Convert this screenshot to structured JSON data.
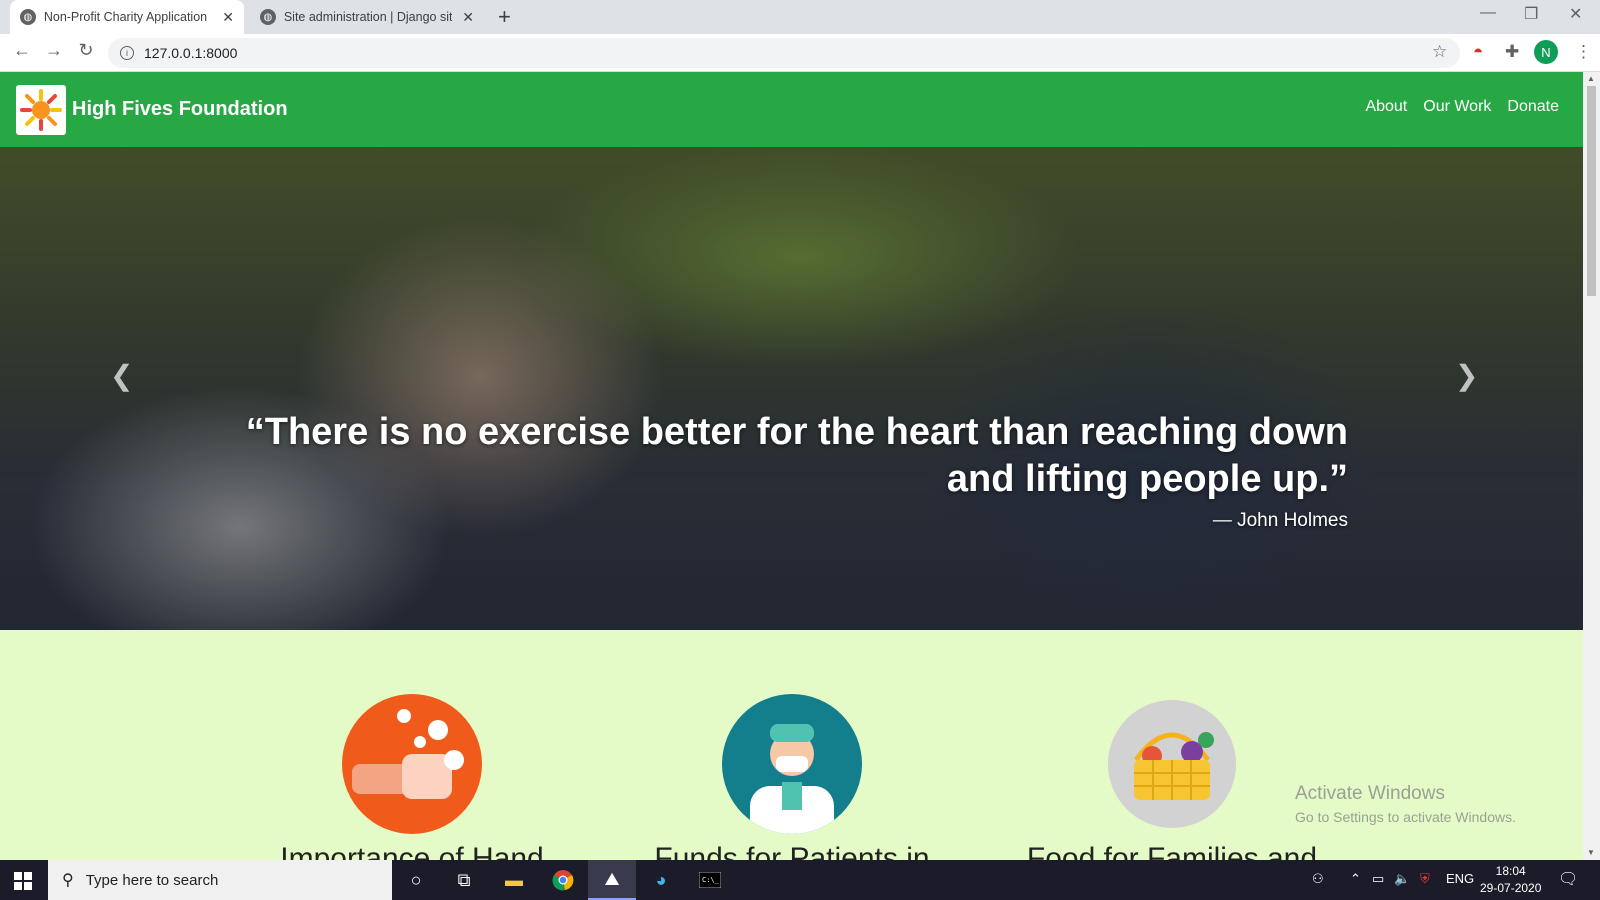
{
  "browser": {
    "tabs": [
      {
        "title": "Non-Profit Charity Application",
        "active": true
      },
      {
        "title": "Site administration | Django site",
        "active": false
      }
    ],
    "address": "127.0.0.1:8000",
    "profile_initial": "N"
  },
  "site": {
    "brand": "High Fives Foundation",
    "nav": [
      "About",
      "Our Work",
      "Donate"
    ],
    "hero": {
      "quote": "“There is no exercise better for the heart than reaching down and lifting people up.”",
      "author": "— John Holmes",
      "slides": 3,
      "active_slide": 3
    },
    "features": [
      {
        "title": "Importance of Hand",
        "icon": "hand-washing-icon",
        "color": "#f05a1a"
      },
      {
        "title": "Funds for Patients in",
        "icon": "doctor-icon",
        "color": "#137e8c"
      },
      {
        "title": "Food for Families and",
        "icon": "food-basket-icon",
        "color": "#d2d2d2"
      }
    ],
    "colors": {
      "nav_bg": "#28a745",
      "features_bg": "#e4fbc8"
    }
  },
  "watermark": {
    "line1": "Activate Windows",
    "line2": "Go to Settings to activate Windows."
  },
  "taskbar": {
    "search_placeholder": "Type here to search",
    "language": "ENG",
    "time": "18:04",
    "date": "29-07-2020"
  }
}
